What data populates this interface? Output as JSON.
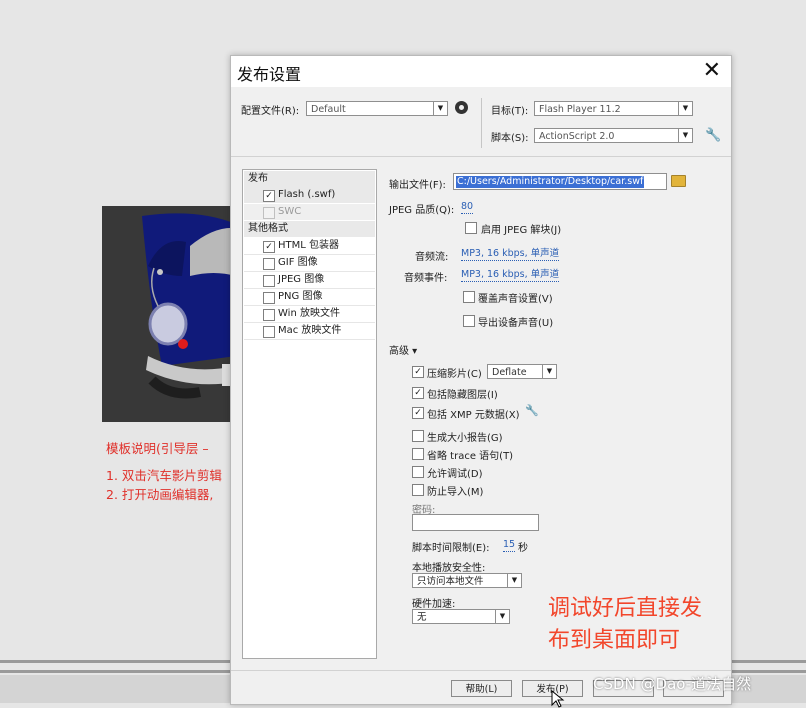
{
  "background": {
    "template_note": "模板说明(引导层 – ",
    "step1": "1. 双击汽车影片剪辑",
    "step2": "2. 打开动画编辑器,"
  },
  "dialog": {
    "title": "发布设置",
    "profile_label": "配置文件(R):",
    "profile_value": "Default",
    "target_label": "目标(T):",
    "target_value": "Flash Player 11.2",
    "script_label": "脚本(S):",
    "script_value": "ActionScript 2.0",
    "left_panel": {
      "publish_header": "发布",
      "flash": "Flash (.swf)",
      "swc": "SWC",
      "other_header": "其他格式",
      "html": "HTML 包装器",
      "gif": "GIF 图像",
      "jpeg": "JPEG 图像",
      "png": "PNG 图像",
      "win": "Win 放映文件",
      "mac": "Mac 放映文件"
    },
    "output_label": "输出文件(F):",
    "output_value": "C:/Users/Administrator/Desktop/car.swf",
    "jpeg_quality_label": "JPEG 品质(Q):",
    "jpeg_quality_value": "80",
    "enable_jpeg": "启用 JPEG 解块(J)",
    "audio_stream_label": "音频流:",
    "audio_stream_value": "MP3, 16 kbps, 单声道",
    "audio_event_label": "音频事件:",
    "audio_event_value": "MP3, 16 kbps, 单声道",
    "override_sound": "覆盖声音设置(V)",
    "export_device_sound": "导出设备声音(U)",
    "advanced_label": "高级 ▾",
    "compress_label": "压缩影片(C)",
    "compress_value": "Deflate",
    "include_hidden": "包括隐藏图层(I)",
    "include_xmp": "包括 XMP 元数据(X)",
    "size_report": "生成大小报告(G)",
    "omit_trace": "省略 trace 语句(T)",
    "permit_debug": "允许调试(D)",
    "protect_import": "防止导入(M)",
    "password_label": "密码:",
    "script_time_label": "脚本时间限制(E):",
    "script_time_value": "15",
    "script_time_unit": "秒",
    "local_security_label": "本地播放安全性:",
    "local_security_value": "只访问本地文件",
    "hw_accel_label": "硬件加速:",
    "hw_accel_value": "无",
    "help_button": "帮助(L)",
    "publish_button": "发布(P)"
  },
  "annotation": {
    "line1": "调试好后直接发",
    "line2": "布到桌面即可"
  },
  "watermark": "CSDN @Dao-道法自然",
  "colors": {
    "annotation": "#f2462b",
    "instruction_red": "#e0302a",
    "link_blue": "#2b5fb4",
    "car_blue": "#0f1a78"
  }
}
